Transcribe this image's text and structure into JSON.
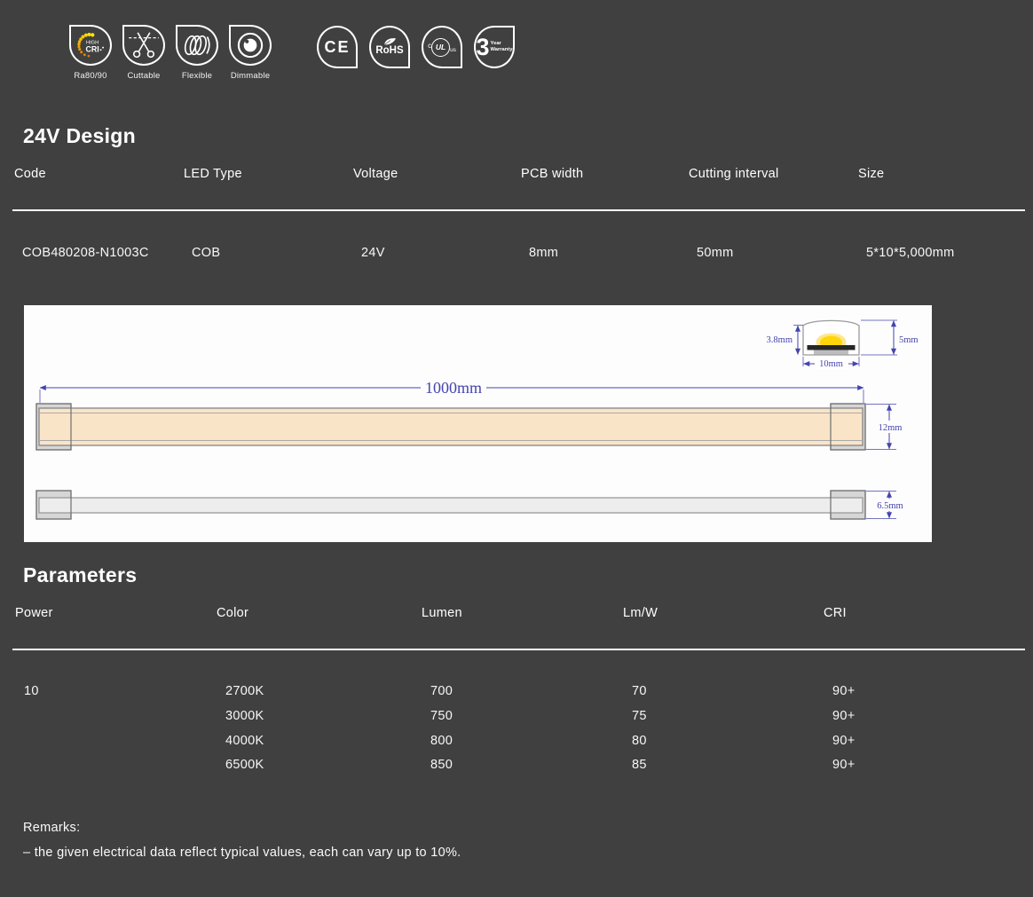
{
  "page": {
    "background": "#404040",
    "accent_dim_color": "#4444af",
    "strip_fill": "#fae4c8"
  },
  "feature_badges": [
    {
      "icon": "high-cri-icon",
      "icon_text_top": "HIGH",
      "icon_text_bottom": "CRI",
      "label": "Ra80/90"
    },
    {
      "icon": "scissors-icon",
      "label": "Cuttable"
    },
    {
      "icon": "coil-icon",
      "label": "Flexible"
    },
    {
      "icon": "dimmer-knob-icon",
      "label": "Dimmable"
    }
  ],
  "certification_badges": {
    "ce": {
      "text": "CE"
    },
    "rohs": {
      "icon": "leaf-icon",
      "text": "RoHS"
    },
    "ul": {
      "prefix": "c",
      "text": "UL",
      "suffix": "us"
    },
    "warranty": {
      "number": "3",
      "line1": "Year",
      "line2": "Warranty"
    }
  },
  "design_section": {
    "title": "24V Design",
    "columns": [
      "Code",
      "LED Type",
      "Voltage",
      "PCB width",
      "Cutting interval",
      "Size"
    ],
    "rows": [
      [
        "COB480208-N1003C",
        "COB",
        "24V",
        "8mm",
        "50mm",
        "5*10*5,000mm"
      ]
    ]
  },
  "drawing": {
    "dims": {
      "length": "1000mm",
      "strip_height": "12mm",
      "side_height": "6.5mm",
      "inner_height": "3.8mm",
      "outer_height": "5mm",
      "width": "10mm"
    }
  },
  "parameters_section": {
    "title": "Parameters",
    "columns": [
      "Power",
      "Color",
      "Lumen",
      "Lm/W",
      "CRI"
    ],
    "power": "10",
    "rows": [
      {
        "color": "2700K",
        "lumen": "700",
        "lmw": "70",
        "cri": "90+"
      },
      {
        "color": "3000K",
        "lumen": "750",
        "lmw": "75",
        "cri": "90+"
      },
      {
        "color": "4000K",
        "lumen": "800",
        "lmw": "80",
        "cri": "90+"
      },
      {
        "color": "6500K",
        "lumen": "850",
        "lmw": "85",
        "cri": "90+"
      }
    ]
  },
  "remarks": {
    "title": "Remarks:",
    "line": "– the given electrical data reflect typical values, each can vary up to 10%."
  }
}
